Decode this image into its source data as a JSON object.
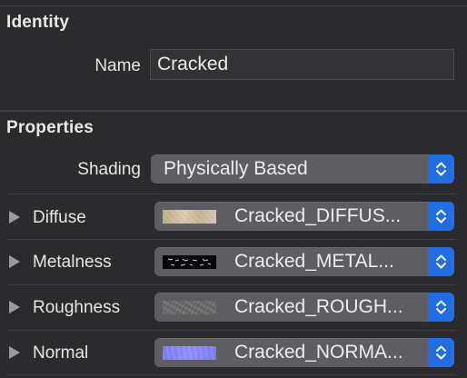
{
  "identity": {
    "section_title": "Identity",
    "name_label": "Name",
    "name_value": "Cracked"
  },
  "properties": {
    "section_title": "Properties",
    "shading_label": "Shading",
    "shading_value": "Physically Based",
    "rows": [
      {
        "label": "Diffuse",
        "texture": "Cracked_DIFFUS..."
      },
      {
        "label": "Metalness",
        "texture": "Cracked_METAL..."
      },
      {
        "label": "Roughness",
        "texture": "Cracked_ROUGH..."
      },
      {
        "label": "Normal",
        "texture": "Cracked_NORMA..."
      }
    ]
  },
  "colors": {
    "accent": "#1f6ee8",
    "background": "#2b2b2d",
    "popup": "#5e5e62"
  }
}
